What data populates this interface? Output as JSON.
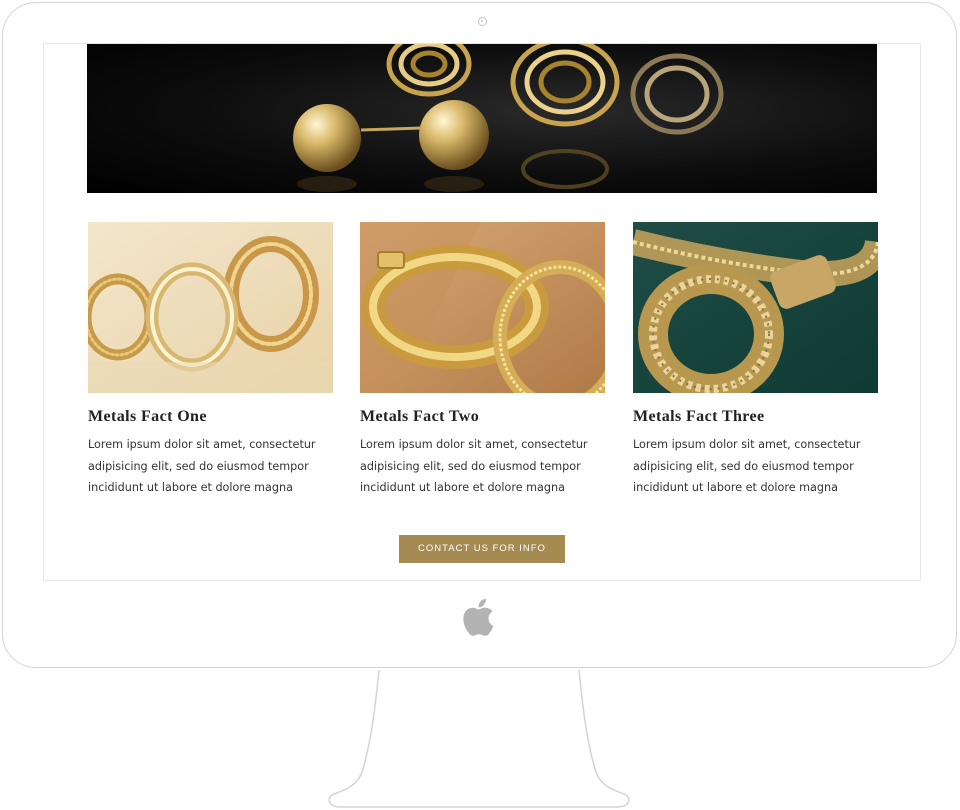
{
  "page": {
    "facts": [
      {
        "title": "Metals Fact One",
        "text": "Lorem ipsum dolor sit amet, consectetur adipisicing elit, sed do eiusmod tempor incididunt ut labore et dolore magna"
      },
      {
        "title": "Metals Fact Two",
        "text": "Lorem ipsum dolor sit amet, consectetur adipisicing elit, sed do eiusmod tempor incididunt ut labore et dolore magna"
      },
      {
        "title": "Metals Fact Three",
        "text": "Lorem ipsum dolor sit amet, consectetur adipisicing elit, sed do eiusmod tempor incididunt ut labore et dolore magna"
      }
    ],
    "cta_label": "CONTACT US FOR INFO"
  },
  "colors": {
    "gold_accent": "#a58a52",
    "heading_text": "#222222",
    "body_text": "#333333",
    "monitor_outline": "#d4d4d4"
  },
  "icons": {
    "brand_logo": "apple-logo-icon",
    "camera": "camera-icon"
  }
}
